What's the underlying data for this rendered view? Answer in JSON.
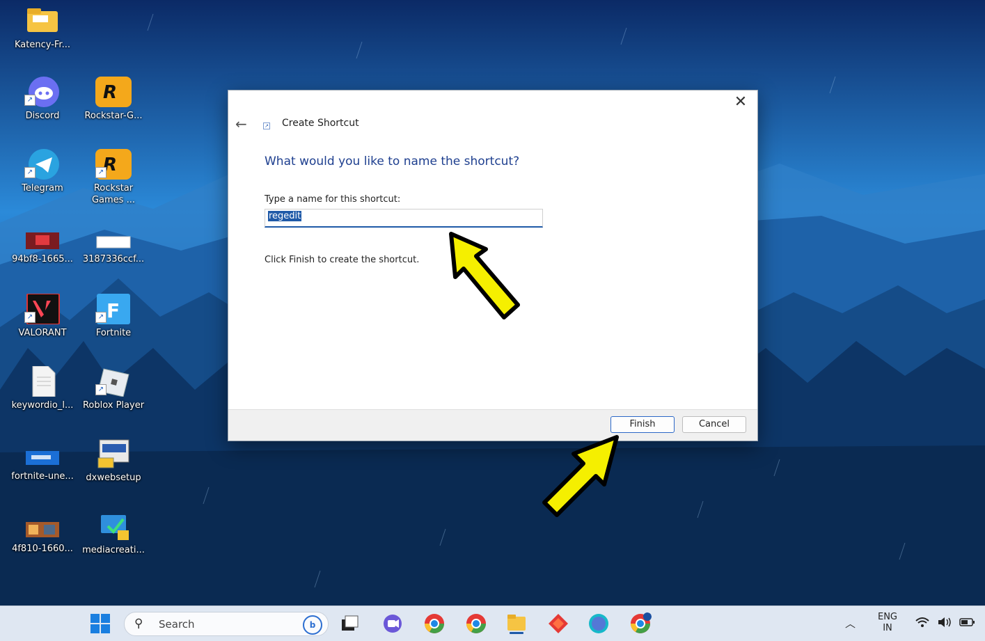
{
  "desktop": {
    "icons": [
      {
        "label": "Katency-Fr...",
        "icon": "folder-icon"
      },
      {
        "label": "Discord",
        "icon": "discord-icon"
      },
      {
        "label": "Rockstar-G...",
        "icon": "rockstar-icon"
      },
      {
        "label": "Telegram",
        "icon": "telegram-icon"
      },
      {
        "label": "Rockstar Games ...",
        "icon": "rockstar-games-icon"
      },
      {
        "label": "94bf8-1665...",
        "icon": "image-file-icon"
      },
      {
        "label": "3187336ccf...",
        "icon": "image-file-icon"
      },
      {
        "label": "VALORANT",
        "icon": "valorant-icon"
      },
      {
        "label": "Fortnite",
        "icon": "fortnite-icon"
      },
      {
        "label": "keywordio_l...",
        "icon": "document-icon"
      },
      {
        "label": "Roblox Player",
        "icon": "roblox-icon"
      },
      {
        "label": "fortnite-une...",
        "icon": "image-file-icon"
      },
      {
        "label": "dxwebsetup",
        "icon": "installer-icon"
      },
      {
        "label": "4f810-1660...",
        "icon": "image-file-icon"
      },
      {
        "label": "mediacreati...",
        "icon": "media-creation-icon"
      }
    ]
  },
  "dialog": {
    "title": "Create Shortcut",
    "heading": "What would you like to name the shortcut?",
    "field_label": "Type a name for this shortcut:",
    "name_value": "regedit",
    "note": "Click Finish to create the shortcut.",
    "finish_label": "Finish",
    "cancel_label": "Cancel",
    "close_glyph": "✕",
    "back_glyph": "←"
  },
  "taskbar": {
    "search_placeholder": "Search",
    "lang_line1": "ENG",
    "lang_line2": "IN",
    "pinned": [
      "file-explorer-icon",
      "chat-icon",
      "chrome-icon",
      "chrome-icon",
      "chrome-icon",
      "file-explorer-icon",
      "app-icon",
      "canva-icon",
      "chrome-icon"
    ]
  },
  "colors": {
    "accent": "#1f5aa8",
    "heading": "#1e3f8f",
    "annotation_arrow": "#f5ef00"
  }
}
